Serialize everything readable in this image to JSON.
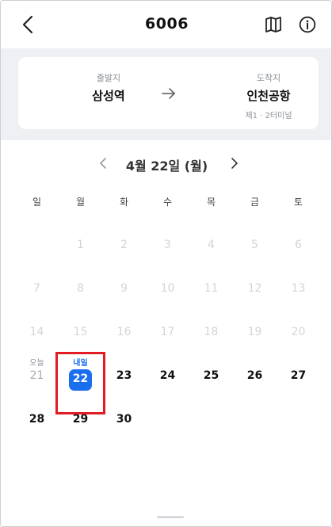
{
  "header": {
    "title": "6006"
  },
  "route": {
    "from": {
      "label": "출발지",
      "name": "삼성역"
    },
    "to": {
      "label": "도착지",
      "name": "인천공항",
      "sub": "제1 · 2터미널"
    }
  },
  "calendar": {
    "month_label": "4월 22일 (월)",
    "weekdays": [
      "일",
      "월",
      "화",
      "수",
      "목",
      "금",
      "토"
    ],
    "weeks": [
      [
        {
          "n": "",
          "s": "empty"
        },
        {
          "n": "1",
          "s": "disabled"
        },
        {
          "n": "2",
          "s": "disabled"
        },
        {
          "n": "3",
          "s": "disabled"
        },
        {
          "n": "4",
          "s": "disabled"
        },
        {
          "n": "5",
          "s": "disabled"
        },
        {
          "n": "6",
          "s": "disabled"
        }
      ],
      [
        {
          "n": "7",
          "s": "disabled"
        },
        {
          "n": "8",
          "s": "disabled"
        },
        {
          "n": "9",
          "s": "disabled"
        },
        {
          "n": "10",
          "s": "disabled"
        },
        {
          "n": "11",
          "s": "disabled"
        },
        {
          "n": "12",
          "s": "disabled"
        },
        {
          "n": "13",
          "s": "disabled"
        }
      ],
      [
        {
          "n": "14",
          "s": "disabled"
        },
        {
          "n": "15",
          "s": "disabled"
        },
        {
          "n": "16",
          "s": "disabled"
        },
        {
          "n": "17",
          "s": "disabled"
        },
        {
          "n": "18",
          "s": "disabled"
        },
        {
          "n": "19",
          "s": "disabled"
        },
        {
          "n": "20",
          "s": "disabled"
        }
      ],
      [
        {
          "n": "21",
          "s": "gray",
          "tag": "오늘"
        },
        {
          "n": "22",
          "s": "sel",
          "tag": "내일"
        },
        {
          "n": "23",
          "s": "active"
        },
        {
          "n": "24",
          "s": "active"
        },
        {
          "n": "25",
          "s": "active"
        },
        {
          "n": "26",
          "s": "active"
        },
        {
          "n": "27",
          "s": "active"
        }
      ],
      [
        {
          "n": "28",
          "s": "active"
        },
        {
          "n": "29",
          "s": "active"
        },
        {
          "n": "30",
          "s": "active"
        },
        {
          "n": "",
          "s": "empty"
        },
        {
          "n": "",
          "s": "empty"
        },
        {
          "n": "",
          "s": "empty"
        },
        {
          "n": "",
          "s": "empty"
        }
      ]
    ]
  },
  "colors": {
    "accent": "#1a6ff0",
    "highlight": "#e31b23"
  }
}
